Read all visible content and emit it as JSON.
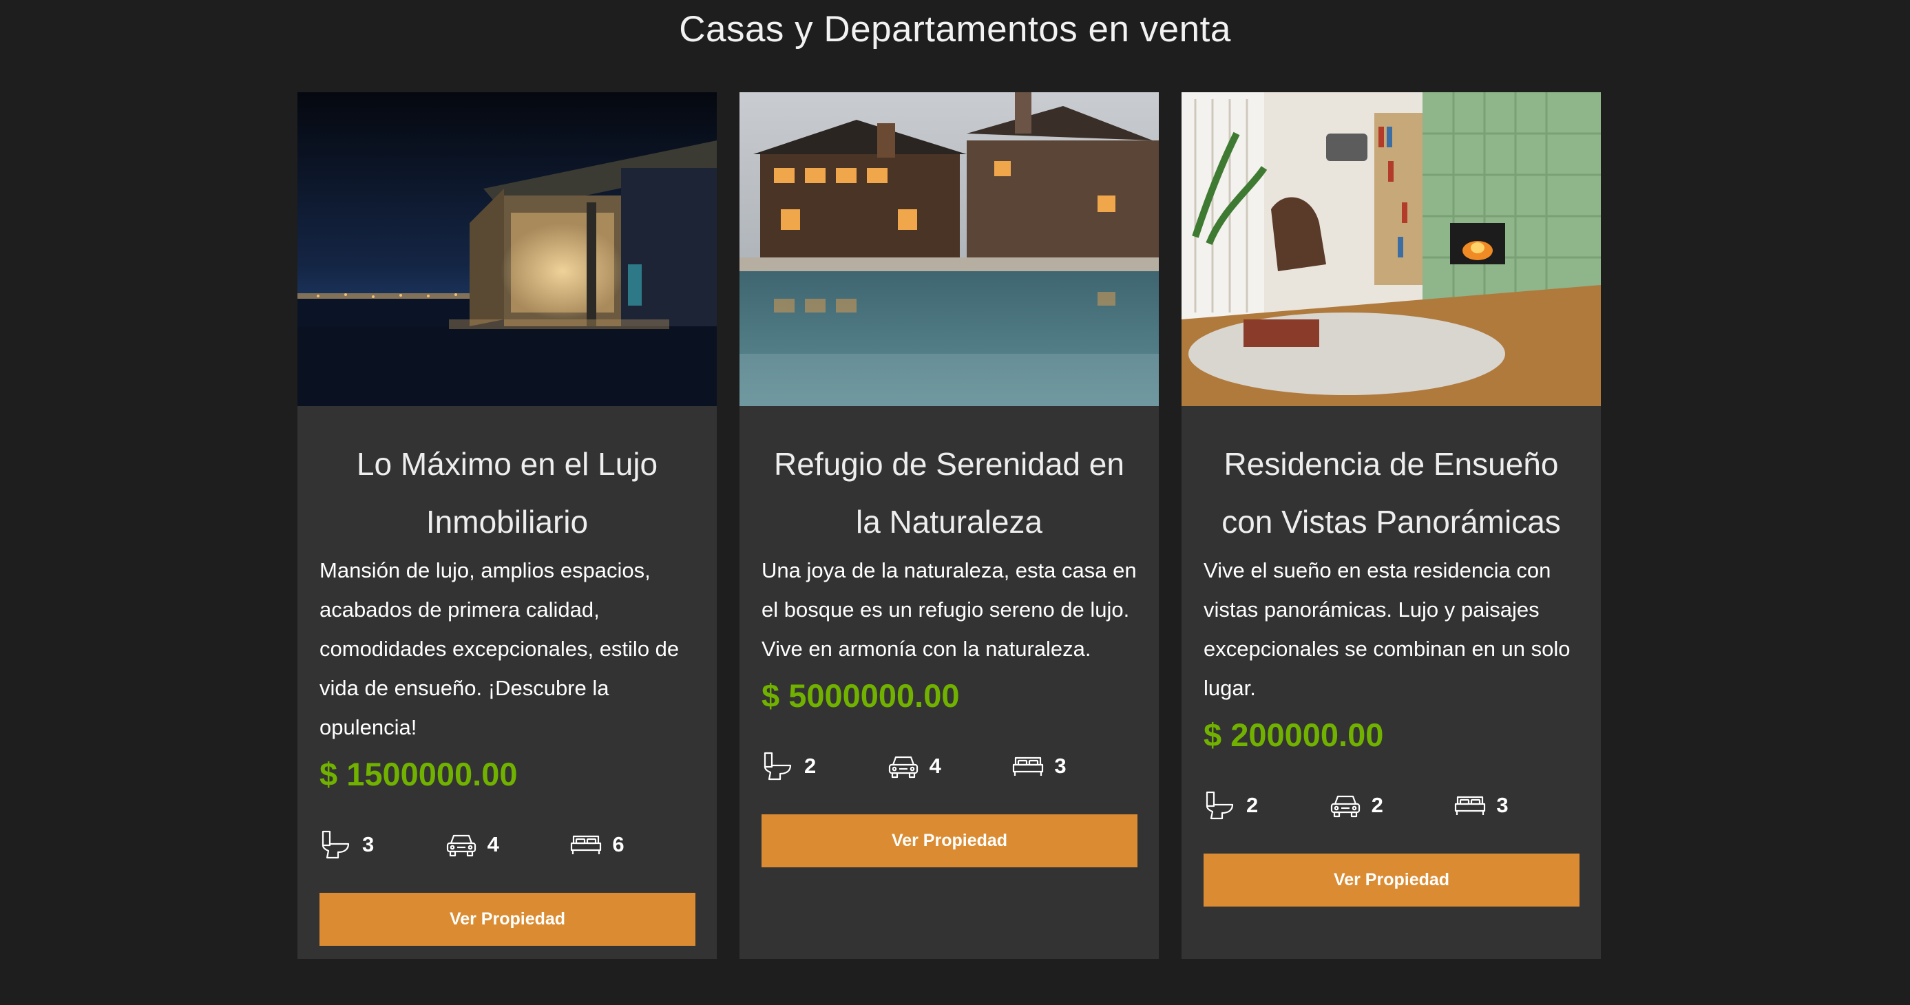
{
  "page": {
    "title": "Casas y Departamentos en venta"
  },
  "listings": [
    {
      "title": "Lo Máximo en el Lujo Inmobiliario",
      "description": "Mansión de lujo, amplios espacios, acabados de primera calidad, comodidades excepcionales, estilo de vida de ensueño. ¡Descubre la opulencia!",
      "price": "$ 1500000.00",
      "bathrooms": "3",
      "parking": "4",
      "bedrooms": "6",
      "button_label": "Ver Propiedad",
      "image": "night-luxury-house-photo"
    },
    {
      "title": "Refugio de Serenidad en la Naturaleza",
      "description": "Una joya de la naturaleza, esta casa en el bosque es un refugio sereno de lujo. Vive en armonía con la naturaleza.",
      "price": "$ 5000000.00",
      "bathrooms": "2",
      "parking": "4",
      "bedrooms": "3",
      "button_label": "Ver Propiedad",
      "image": "lodge-with-pool-photo"
    },
    {
      "title": "Residencia de Ensueño con Vistas Panorámicas",
      "description": "Vive el sueño en esta residencia con vistas panorámicas. Lujo y paisajes excepcionales se combinan en un solo lugar.",
      "price": "$ 200000.00",
      "bathrooms": "2",
      "parking": "2",
      "bedrooms": "3",
      "button_label": "Ver Propiedad",
      "image": "living-room-fireplace-photo"
    }
  ],
  "icons": {
    "bathroom": "toilet-icon",
    "parking": "car-icon",
    "bedroom": "bed-icon"
  },
  "colors": {
    "background": "#1e1e1e",
    "card": "#333333",
    "price": "#71b100",
    "button": "#db8c32"
  }
}
